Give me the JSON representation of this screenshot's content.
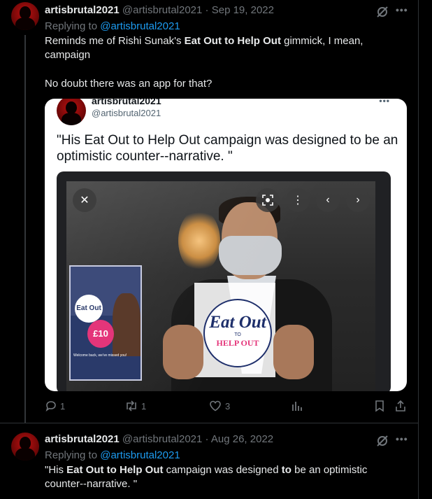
{
  "tweet1": {
    "display_name": "artisbrutal2021",
    "handle": "@artisbrutal2021",
    "separator": "·",
    "date": "Sep 19, 2022",
    "replying_prefix": "Replying to",
    "replying_handle": "@artisbrutal2021",
    "text_part1": "Reminds me of Rishi Sunak's ",
    "text_bold": "Eat Out to Help Out",
    "text_part2": " gimmick, I mean, campaign",
    "text_line3": "No doubt there was an app for that?",
    "embed": {
      "display_name": "artisbrutal2021",
      "handle": "@artisbrutal2021",
      "text": "\"His Eat Out to Help Out campaign was designed to be an optimistic counter--narrative. \"",
      "photo": {
        "poster_disc": "Eat Out",
        "poster_price": "£10",
        "poster_footer": "Welcome back, we've missed you!",
        "logo_line1": "Eat Out",
        "logo_line2": "TO",
        "logo_line3": "HELP OUT"
      }
    },
    "actions": {
      "replies": "1",
      "retweets": "1",
      "likes": "3"
    }
  },
  "tweet2": {
    "display_name": "artisbrutal2021",
    "handle": "@artisbrutal2021",
    "separator": "·",
    "date": "Aug 26, 2022",
    "replying_prefix": "Replying to",
    "replying_handle": "@artisbrutal2021",
    "text_part1": "\"His ",
    "text_bold1": "Eat Out to Help Out",
    "text_part2": " campaign was designed ",
    "text_bold2": "to",
    "text_part3": " be an optimistic counter--narrative. \""
  },
  "colors": {
    "background": "#000000",
    "text": "#e7e9ea",
    "muted": "#71767b",
    "link": "#1d9bf0",
    "divider": "#2f3336"
  }
}
